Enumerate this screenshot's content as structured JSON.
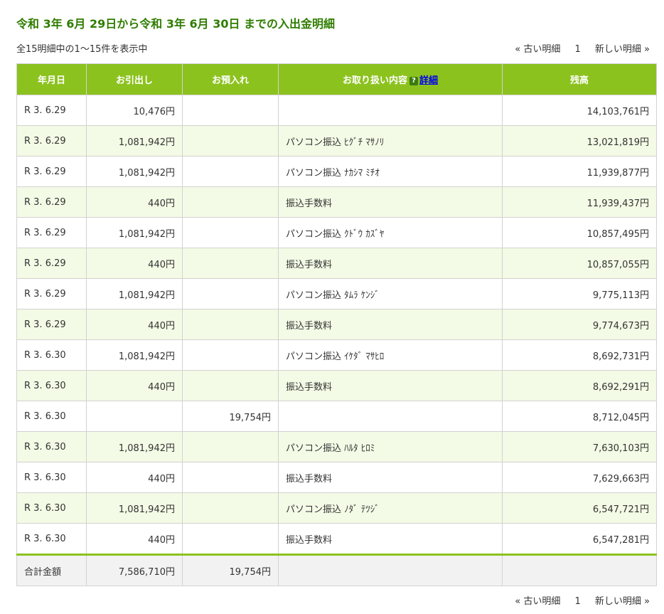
{
  "page": {
    "title": "令和 3年 6月 29日から令和 3年 6月 30日 までの入出金明細",
    "summary": "全15明細中の1～15件を表示中"
  },
  "pager": {
    "prev": "« 古い明細",
    "page": "1",
    "next": "新しい明細 »"
  },
  "table": {
    "headers": {
      "date": "年月日",
      "withdrawal": "お引出し",
      "deposit": "お預入れ",
      "description": "お取り扱い内容",
      "help_icon": "?",
      "detail_link": "詳細",
      "balance": "残高"
    },
    "rows": [
      {
        "date": "R 3. 6.29",
        "withdrawal": "10,476円",
        "deposit": "",
        "description": "",
        "balance": "14,103,761円"
      },
      {
        "date": "R 3. 6.29",
        "withdrawal": "1,081,942円",
        "deposit": "",
        "description": "パソコン振込 ﾋｸﾞﾁ ﾏｻﾉﾘ",
        "balance": "13,021,819円"
      },
      {
        "date": "R 3. 6.29",
        "withdrawal": "1,081,942円",
        "deposit": "",
        "description": "パソコン振込 ﾅｶｼﾏ ﾐﾁｵ",
        "balance": "11,939,877円"
      },
      {
        "date": "R 3. 6.29",
        "withdrawal": "440円",
        "deposit": "",
        "description": "振込手数料",
        "balance": "11,939,437円"
      },
      {
        "date": "R 3. 6.29",
        "withdrawal": "1,081,942円",
        "deposit": "",
        "description": "パソコン振込 ｸﾄﾞｳ ｶｽﾞﾔ",
        "balance": "10,857,495円"
      },
      {
        "date": "R 3. 6.29",
        "withdrawal": "440円",
        "deposit": "",
        "description": "振込手数料",
        "balance": "10,857,055円"
      },
      {
        "date": "R 3. 6.29",
        "withdrawal": "1,081,942円",
        "deposit": "",
        "description": "パソコン振込 ﾀﾑﾗ ｹﾝｼﾞ",
        "balance": "9,775,113円"
      },
      {
        "date": "R 3. 6.29",
        "withdrawal": "440円",
        "deposit": "",
        "description": "振込手数料",
        "balance": "9,774,673円"
      },
      {
        "date": "R 3. 6.30",
        "withdrawal": "1,081,942円",
        "deposit": "",
        "description": "パソコン振込 ｲｹﾀﾞ ﾏｻﾋﾛ",
        "balance": "8,692,731円"
      },
      {
        "date": "R 3. 6.30",
        "withdrawal": "440円",
        "deposit": "",
        "description": "振込手数料",
        "balance": "8,692,291円"
      },
      {
        "date": "R 3. 6.30",
        "withdrawal": "",
        "deposit": "19,754円",
        "description": "",
        "balance": "8,712,045円"
      },
      {
        "date": "R 3. 6.30",
        "withdrawal": "1,081,942円",
        "deposit": "",
        "description": "パソコン振込 ﾊﾙﾀ ﾋﾛﾐ",
        "balance": "7,630,103円"
      },
      {
        "date": "R 3. 6.30",
        "withdrawal": "440円",
        "deposit": "",
        "description": "振込手数料",
        "balance": "7,629,663円"
      },
      {
        "date": "R 3. 6.30",
        "withdrawal": "1,081,942円",
        "deposit": "",
        "description": "パソコン振込 ﾉﾀﾞ ﾃﾂｼﾞ",
        "balance": "6,547,721円"
      },
      {
        "date": "R 3. 6.30",
        "withdrawal": "440円",
        "deposit": "",
        "description": "振込手数料",
        "balance": "6,547,281円"
      }
    ],
    "total": {
      "label": "合計金額",
      "withdrawal": "7,586,710円",
      "deposit": "19,754円",
      "description": "",
      "balance": ""
    }
  },
  "colors": {
    "title": "#2f7d00",
    "header_bg": "#8cc21e",
    "row_alt_bg": "#f3fae5",
    "total_bg": "#f2f2f2",
    "link": "#0000ee"
  },
  "icons": {
    "help": "question-mark-square-icon"
  }
}
